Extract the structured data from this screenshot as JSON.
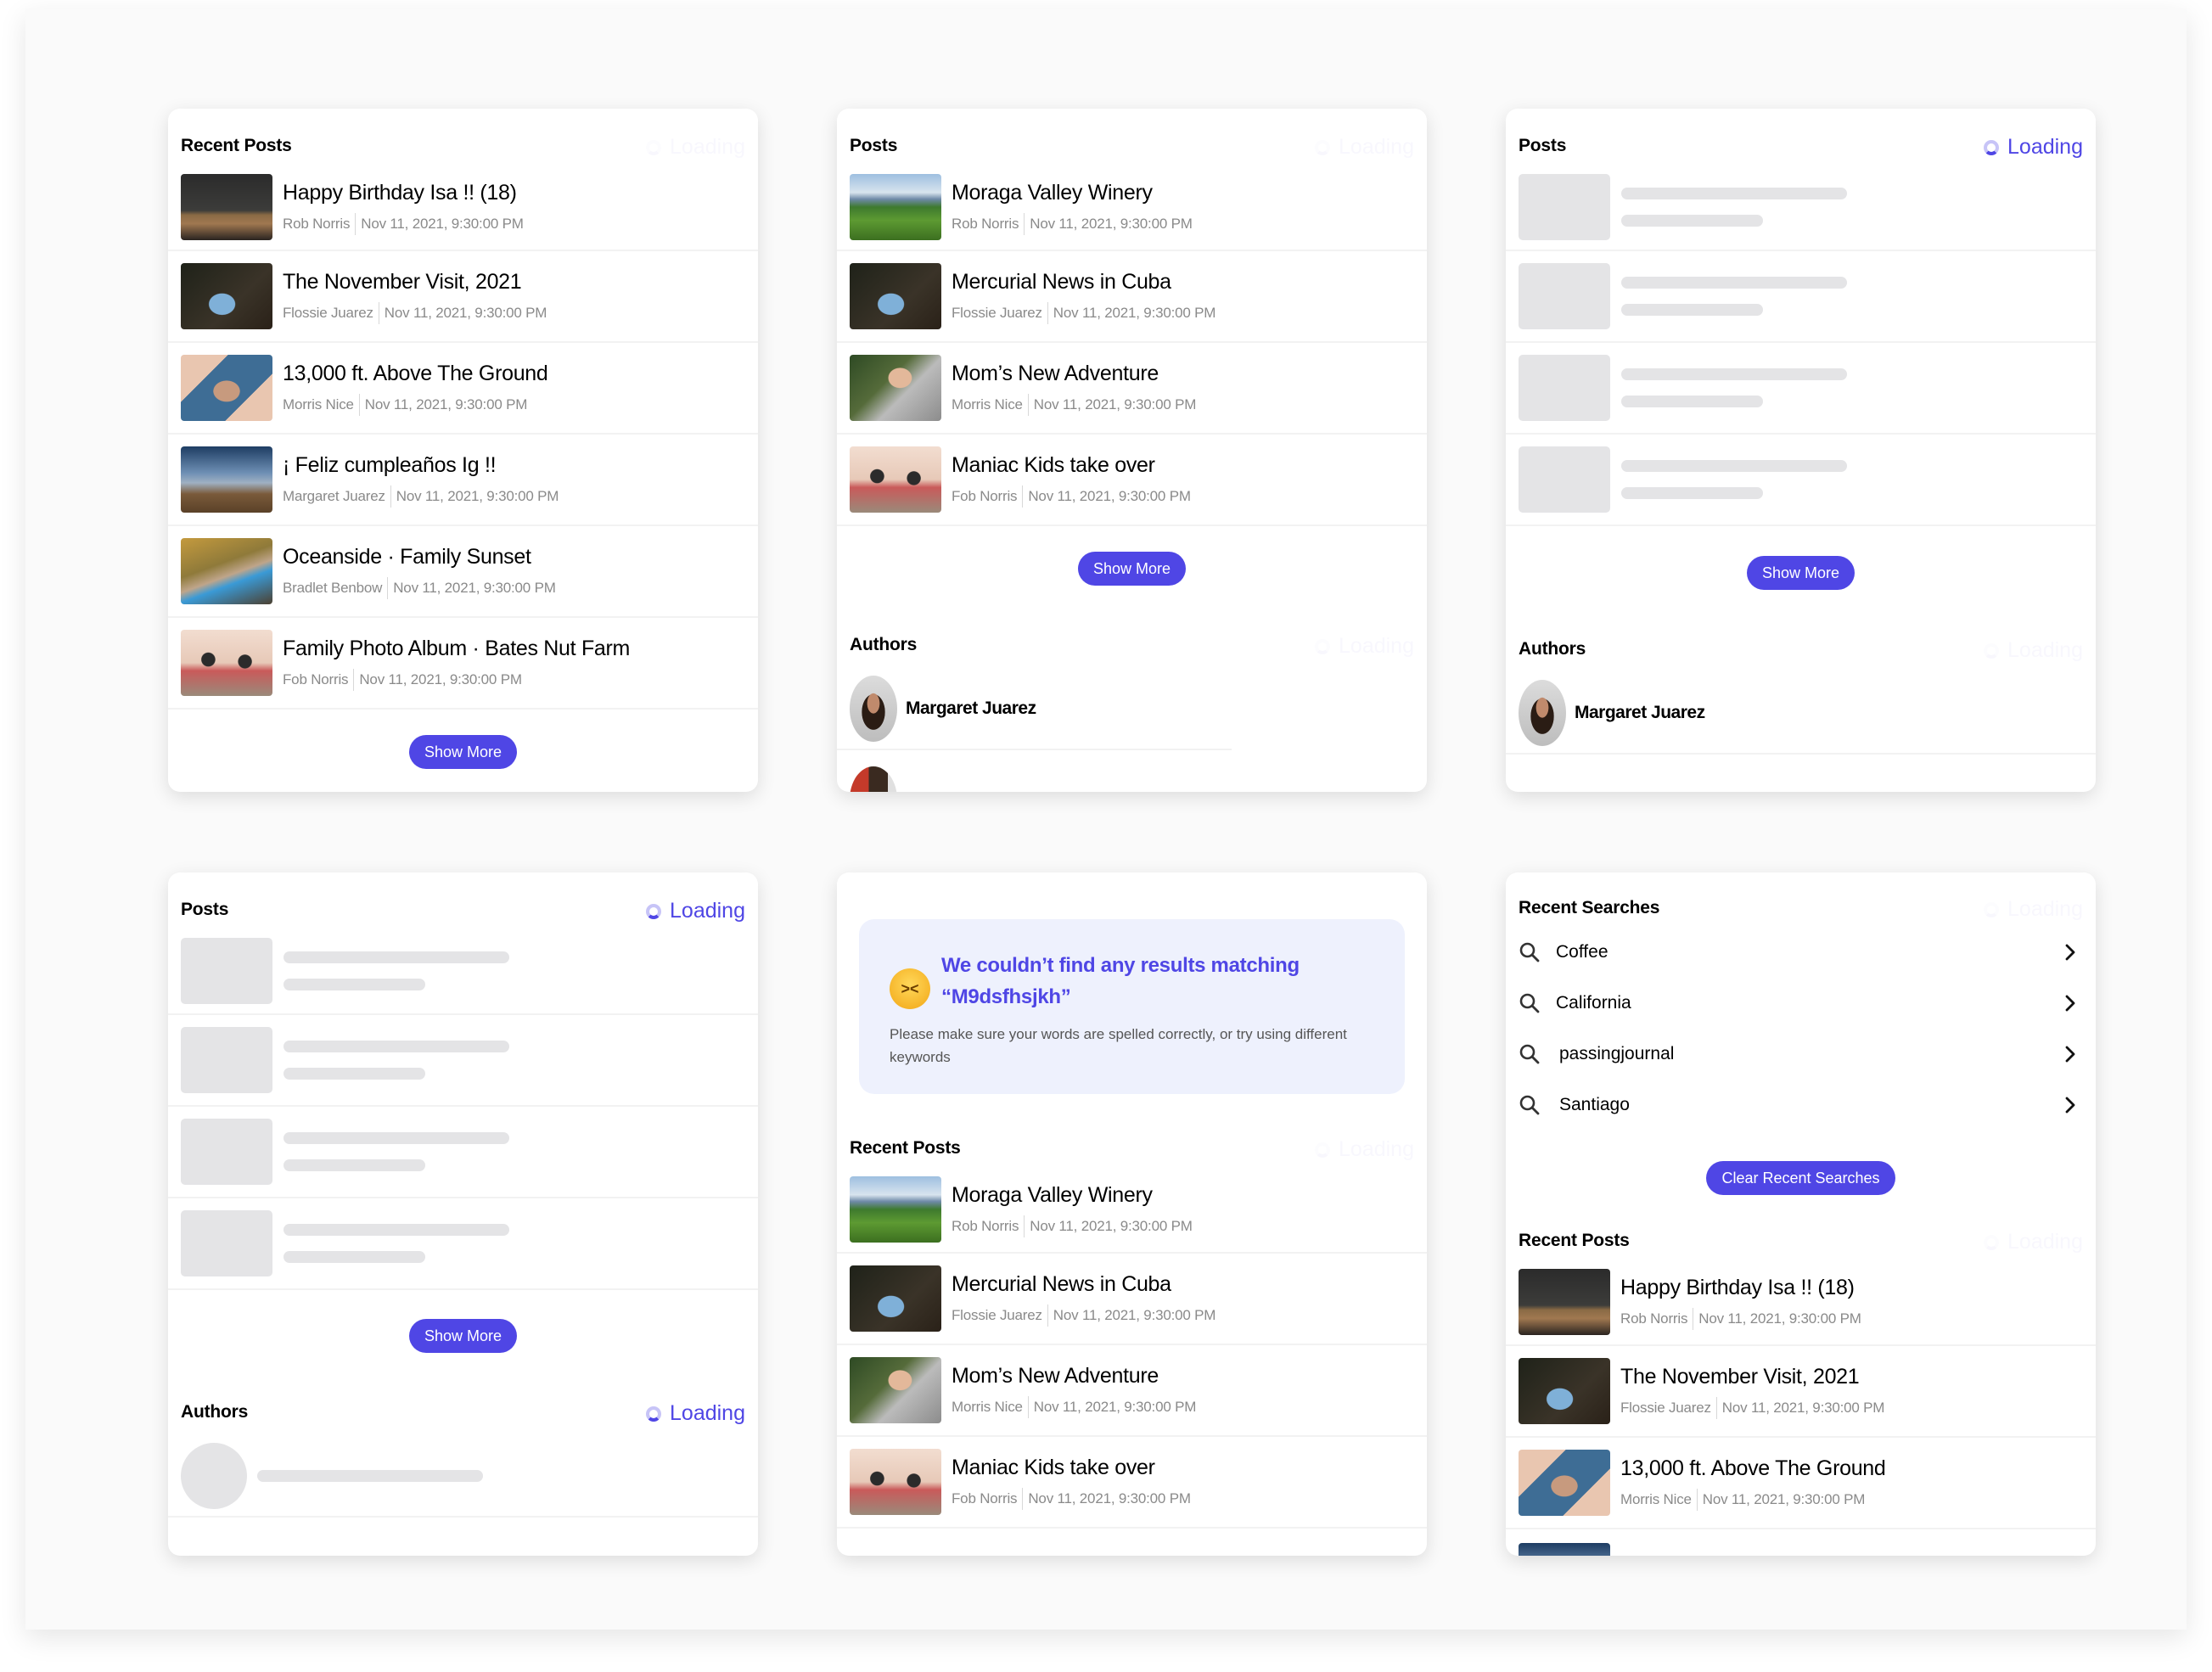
{
  "colors": {
    "accent": "#4f46e5",
    "skeleton": "#e4e4e6",
    "empty_bg": "#eef1fd",
    "meta_text": "#8a8a8a"
  },
  "loading_label": "Loading",
  "show_more_label": "Show More",
  "card1": {
    "title": "Recent Posts",
    "posts": [
      {
        "title": "Happy Birthday Isa !! (18)",
        "author": "Rob Norris",
        "date": "Nov 11, 2021, 9:30:00 PM",
        "image": "office-desk"
      },
      {
        "title": "The November Visit, 2021",
        "author": "Flossie Juarez",
        "date": "Nov 11, 2021, 9:30:00 PM",
        "image": "blue-beetle-car"
      },
      {
        "title": "13,000 ft. Above The Ground",
        "author": "Morris Nice",
        "date": "Nov 11, 2021, 9:30:00 PM",
        "image": "hands-frame-face"
      },
      {
        "title": "¡ Feliz cumpleaños Ig !!",
        "author": "Margaret Juarez",
        "date": "Nov 11, 2021, 9:30:00 PM",
        "image": "desert-sky"
      },
      {
        "title": "Oceanside · Family Sunset",
        "author": "Bradlet Benbow",
        "date": "Nov 11, 2021, 9:30:00 PM",
        "image": "pool-party"
      },
      {
        "title": "Family Photo Album · Bates Nut Farm",
        "author": "Fob Norris",
        "date": "Nov 11, 2021, 9:30:00 PM",
        "image": "family-dinner"
      }
    ]
  },
  "card2": {
    "title": "Posts",
    "posts": [
      {
        "title": "Moraga Valley Winery",
        "author": "Rob Norris",
        "date": "Nov 11, 2021, 9:30:00 PM",
        "image": "winery"
      },
      {
        "title": "Mercurial News in Cuba",
        "author": "Flossie Juarez",
        "date": "Nov 11, 2021, 9:30:00 PM",
        "image": "blue-beetle-car"
      },
      {
        "title": "Mom’s New Adventure",
        "author": "Morris Nice",
        "date": "Nov 11, 2021, 9:30:00 PM",
        "image": "mother-child"
      },
      {
        "title": "Maniac Kids take over",
        "author": "Fob Norris",
        "date": "Nov 11, 2021, 9:30:00 PM",
        "image": "family-dinner"
      }
    ],
    "authors_title": "Authors",
    "authors": [
      {
        "name": "Margaret Juarez"
      },
      {
        "name": ""
      }
    ]
  },
  "card3": {
    "title": "Posts",
    "skeleton_rows": 4,
    "authors_title": "Authors",
    "authors": [
      {
        "name": "Margaret Juarez"
      }
    ]
  },
  "card4": {
    "title": "Posts",
    "skeleton_rows": 4,
    "authors_title": "Authors"
  },
  "card5": {
    "empty_state": {
      "emoji": "confounded-face",
      "title_line1": "We couldn’t find any results matching",
      "title_line2": "“M9dsfhsjkh”",
      "body": "Please make sure your words are spelled correctly, or try using different keywords"
    },
    "title": "Recent Posts",
    "posts": [
      {
        "title": "Moraga Valley Winery",
        "author": "Rob Norris",
        "date": "Nov 11, 2021, 9:30:00 PM",
        "image": "winery"
      },
      {
        "title": "Mercurial News in Cuba",
        "author": "Flossie Juarez",
        "date": "Nov 11, 2021, 9:30:00 PM",
        "image": "blue-beetle-car"
      },
      {
        "title": "Mom’s New Adventure",
        "author": "Morris Nice",
        "date": "Nov 11, 2021, 9:30:00 PM",
        "image": "mother-child"
      },
      {
        "title": "Maniac Kids take over",
        "author": "Fob Norris",
        "date": "Nov 11, 2021, 9:30:00 PM",
        "image": "family-dinner"
      }
    ]
  },
  "card6": {
    "searches_title": "Recent Searches",
    "searches": [
      "Coffee",
      "California",
      "passingjournal",
      "Santiago"
    ],
    "clear_label": "Clear Recent Searches",
    "title": "Recent Posts",
    "posts": [
      {
        "title": "Happy Birthday Isa !! (18)",
        "author": "Rob Norris",
        "date": "Nov 11, 2021, 9:30:00 PM",
        "image": "office-desk"
      },
      {
        "title": "The November Visit, 2021",
        "author": "Flossie Juarez",
        "date": "Nov 11, 2021, 9:30:00 PM",
        "image": "blue-beetle-car"
      },
      {
        "title": "13,000 ft. Above The Ground",
        "author": "Morris Nice",
        "date": "Nov 11, 2021, 9:30:00 PM",
        "image": "hands-frame-face"
      },
      {
        "title": "",
        "author": "",
        "date": "",
        "image": "desert-sky"
      }
    ]
  }
}
